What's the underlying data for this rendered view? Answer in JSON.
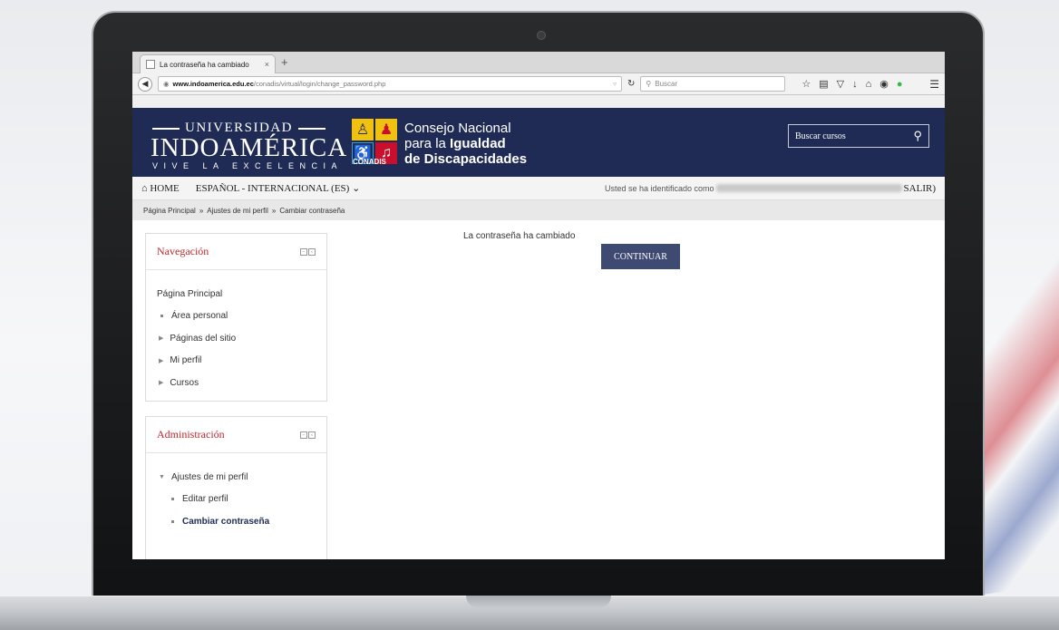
{
  "browser": {
    "tab_title": "La contraseña ha cambiado",
    "tab_close": "×",
    "new_tab": "+",
    "url_domain": "www.indoamerica.edu.ec",
    "url_path": "/conadis/virtual/login/change_password.php",
    "search_placeholder": "Buscar",
    "icons": [
      "back-arrow-icon",
      "globe-icon",
      "reload-icon",
      "search-icon",
      "star-icon",
      "clipboard-icon",
      "pocket-icon",
      "download-icon",
      "home-icon",
      "chat-icon",
      "green-circle-icon",
      "menu-icon"
    ]
  },
  "header": {
    "uni_top": "UNIVERSIDAD",
    "uni_main": "INDOAMÉRICA",
    "uni_sub": "VIVE LA EXCELENCIA",
    "conadis_label": "CONADIS",
    "consejo_line1": "Consejo Nacional",
    "consejo_line2_pre": "para la ",
    "consejo_line2_bold": "Igualdad",
    "consejo_line3": "de Discapacidades",
    "search_label": "Buscar cursos"
  },
  "menubar": {
    "home": "HOME",
    "language": "ESPAÑOL - INTERNACIONAL (ES)",
    "login_prefix": "Usted se ha identificado como",
    "logout": "SALIR)"
  },
  "breadcrumb": [
    "Página Principal",
    "Ajustes de mi perfil",
    "Cambiar contraseña"
  ],
  "breadcrumb_sep": "»",
  "navigation": {
    "title": "Navegación",
    "root": "Página Principal",
    "items": [
      "Área personal",
      "Páginas del sitio",
      "Mi perfil",
      "Cursos"
    ]
  },
  "administration": {
    "title": "Administración",
    "section": "Ajustes de mi perfil",
    "items": [
      "Editar perfil",
      "Cambiar contraseña"
    ]
  },
  "main": {
    "message": "La contraseña ha cambiado",
    "continue_label": "CONTINUAR"
  },
  "colors": {
    "header_bg": "#1f2b54",
    "block_title": "#c1272d",
    "button_bg": "#3f4a72"
  }
}
